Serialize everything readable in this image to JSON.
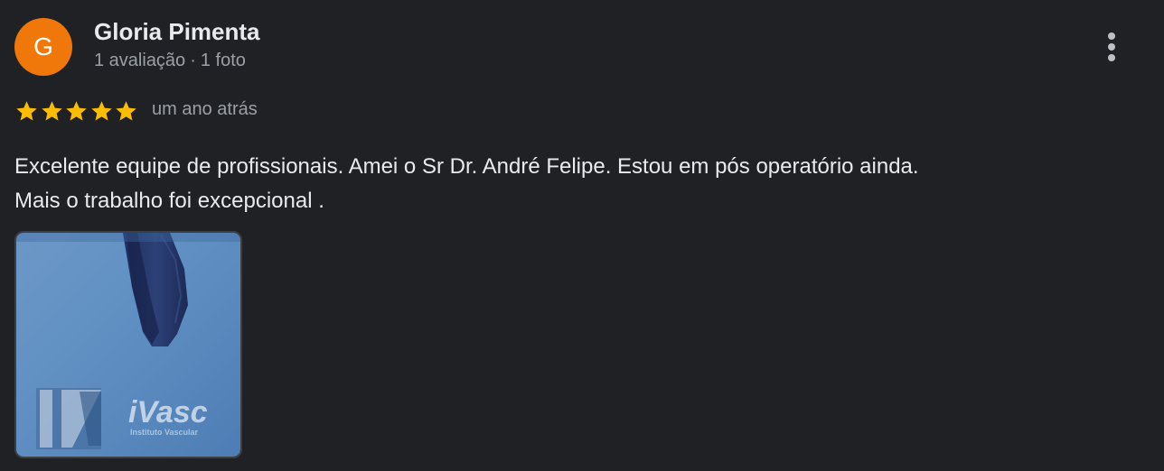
{
  "review": {
    "author": {
      "initial": "G",
      "name": "Gloria Pimenta",
      "review_count": "1 avaliação",
      "separator": "·",
      "photo_count": "1 foto",
      "avatar_color": "#f0780a"
    },
    "rating": 5,
    "max_rating": 5,
    "star_color": "#fbbc04",
    "time_ago": "um ano atrás",
    "text_line1": "Excelente equipe de profissionais. Amei o Sr Dr. André Felipe. Estou em pós operatório ainda.",
    "text_line2": "Mais o trabalho foi excepcional .",
    "photos": [
      {
        "brand_text": "iVasc",
        "brand_subtext": "Instituto Vascular"
      }
    ]
  }
}
